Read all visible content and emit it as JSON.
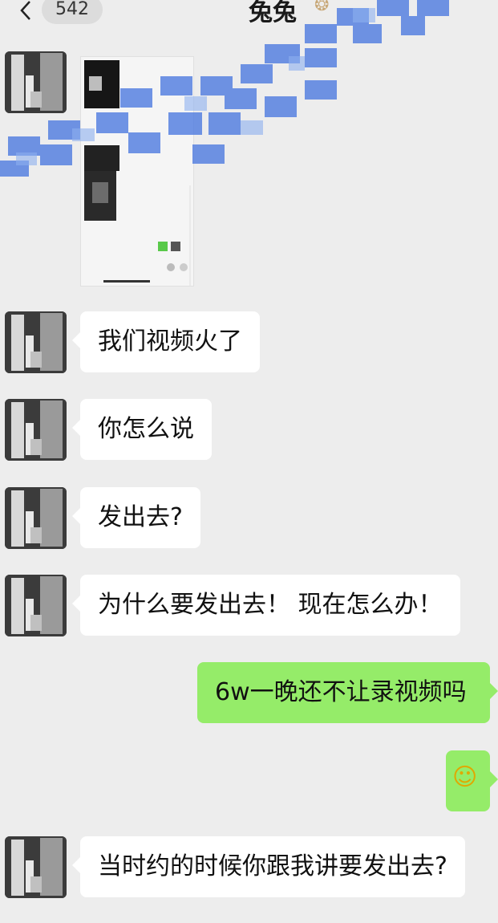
{
  "header": {
    "back_badge": "542",
    "title": "兔兔",
    "title_emoji": "❂"
  },
  "icons": {
    "back": "chevron-left-icon",
    "avatar": "contact-avatar"
  },
  "colors": {
    "background": "#ededed",
    "incoming_bubble": "#ffffff",
    "outgoing_bubble": "#95ec69",
    "mosaic": "#4a78e0"
  },
  "messages": [
    {
      "direction": "in",
      "type": "image",
      "text": ""
    },
    {
      "direction": "in",
      "type": "text",
      "text": "我们视频火了"
    },
    {
      "direction": "in",
      "type": "text",
      "text": "你怎么说"
    },
    {
      "direction": "in",
      "type": "text",
      "text": "发出去?"
    },
    {
      "direction": "in",
      "type": "text",
      "text": "为什么要发出去！ 现在怎么办！"
    },
    {
      "direction": "out",
      "type": "text",
      "text": "6w一晚还不让录视频吗"
    },
    {
      "direction": "out",
      "type": "emoji",
      "text": "☺"
    },
    {
      "direction": "in",
      "type": "text",
      "text": "当时约的时候你跟我讲要发出去?"
    }
  ]
}
